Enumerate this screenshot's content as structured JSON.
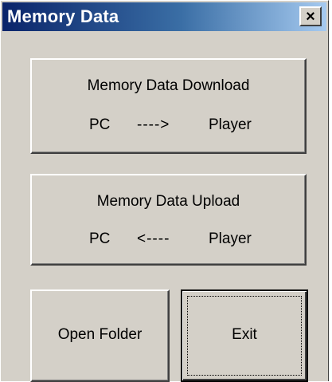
{
  "window": {
    "title": "Memory Data",
    "close_label": "×"
  },
  "buttons": {
    "download": {
      "title": "Memory Data Download",
      "source": "PC",
      "arrow": "---->",
      "target": "Player"
    },
    "upload": {
      "title": "Memory Data Upload",
      "source": "PC",
      "arrow": "<----",
      "target": "Player"
    },
    "open_folder": "Open Folder",
    "exit": "Exit"
  },
  "icons": {
    "close": "close-icon"
  }
}
